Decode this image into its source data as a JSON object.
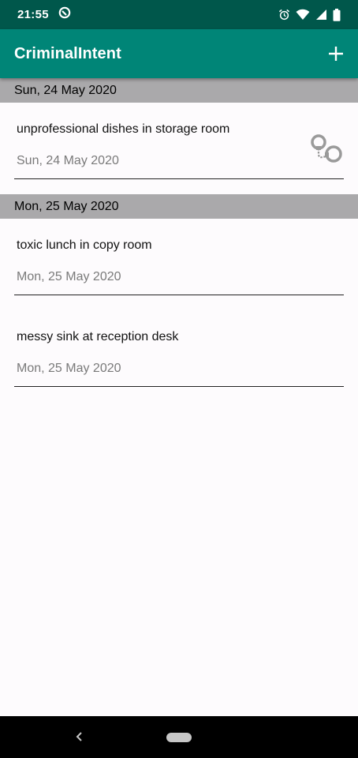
{
  "status_bar": {
    "time": "21:55",
    "icons": [
      "data-saver-icon",
      "alarm-icon",
      "wifi-icon",
      "signal-icon",
      "battery-icon"
    ]
  },
  "app_bar": {
    "title": "CriminalIntent",
    "add_icon": "plus-icon",
    "color": "#008577"
  },
  "sections": [
    {
      "header": "Sun, 24 May 2020",
      "crimes": [
        {
          "title": "unprofessional dishes in storage room",
          "date": "Sun, 24 May 2020",
          "solved": true
        }
      ]
    },
    {
      "header": "Mon, 25 May 2020",
      "crimes": [
        {
          "title": "toxic lunch in copy room",
          "date": "Mon, 25 May 2020",
          "solved": false
        },
        {
          "title": "messy sink at reception desk",
          "date": "Mon, 25 May 2020",
          "solved": false
        }
      ]
    }
  ],
  "nav_bar": {
    "icons": [
      "back-icon",
      "home-pill-icon"
    ]
  }
}
